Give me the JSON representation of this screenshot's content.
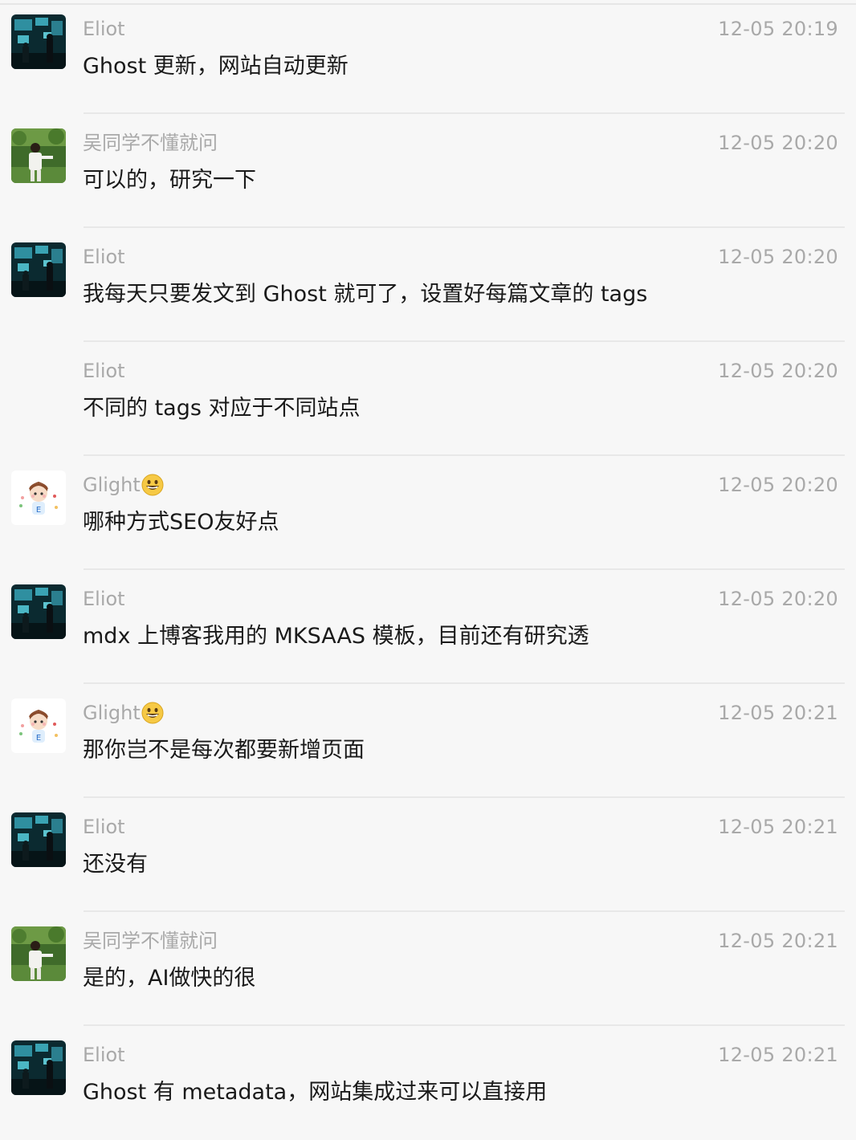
{
  "messages": [
    {
      "sender": "Eliot",
      "time": "12-05 20:19",
      "text": "Ghost 更新，网站自动更新",
      "avatar": "eliot-avatar"
    },
    {
      "sender": "吴同学不懂就问",
      "time": "12-05 20:20",
      "text": "可以的，研究一下",
      "avatar": "wu-avatar"
    },
    {
      "sender": "Eliot",
      "time": "12-05 20:20",
      "text": "我每天只要发文到 Ghost 就可了，设置好每篇文章的 tags",
      "avatar": "eliot-avatar"
    },
    {
      "sender": "Eliot",
      "time": "12-05 20:20",
      "text": "不同的 tags 对应于不同站点",
      "avatar": "none"
    },
    {
      "sender": "Glight",
      "sender_emoji": "grinning-face-icon",
      "time": "12-05 20:20",
      "text": "哪种方式SEO友好点",
      "avatar": "glight-avatar"
    },
    {
      "sender": "Eliot",
      "time": "12-05 20:20",
      "text": "mdx 上博客我用的 MKSAAS 模板，目前还有研究透",
      "avatar": "eliot-avatar"
    },
    {
      "sender": "Glight",
      "sender_emoji": "grinning-face-icon",
      "time": "12-05 20:21",
      "text": "那你岂不是每次都要新增页面",
      "avatar": "glight-avatar"
    },
    {
      "sender": "Eliot",
      "time": "12-05 20:21",
      "text": "还没有",
      "avatar": "eliot-avatar"
    },
    {
      "sender": "吴同学不懂就问",
      "time": "12-05 20:21",
      "text": "是的，AI做快的很",
      "avatar": "wu-avatar"
    },
    {
      "sender": "Eliot",
      "time": "12-05 20:21",
      "text": "Ghost 有 metadata，网站集成过来可以直接用",
      "avatar": "eliot-avatar"
    }
  ],
  "colors": {
    "background": "#f7f7f7",
    "meta_text": "#a9a9a9",
    "message_text": "#1a1a1a",
    "divider": "#e8e8e8"
  }
}
